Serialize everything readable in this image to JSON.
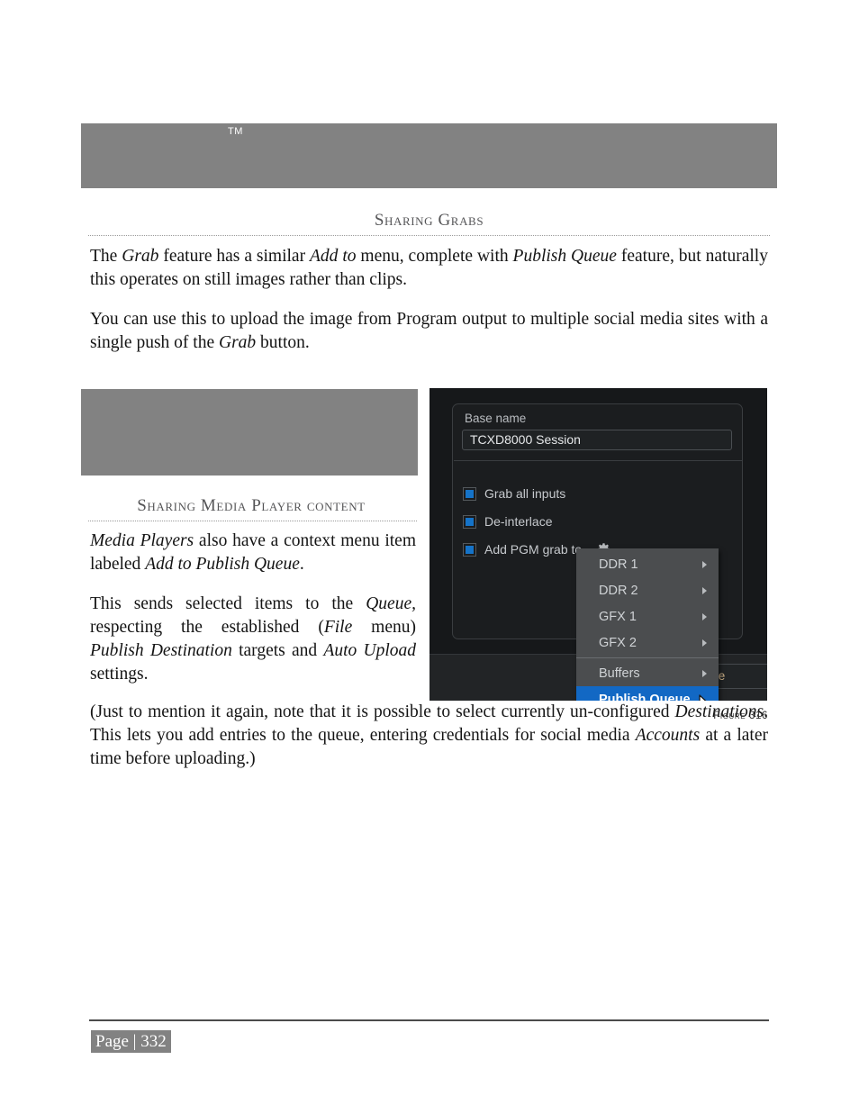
{
  "document": {
    "header_band": {
      "trademark": "TM"
    },
    "footer": {
      "page_label": "Page | 332"
    },
    "figure_caption": "Figure 316"
  },
  "sections": [
    {
      "heading": "Sharing Grabs"
    },
    {
      "heading": "Sharing Media Player content"
    }
  ],
  "paragraphs": {
    "grab_feature": {
      "part1": "The ",
      "em1": "Grab",
      "part2": " feature has a similar ",
      "em2": "Add to",
      "part3": " menu, complete with ",
      "em3": "Publish Queue",
      "part4": " feature, but naturally this operates on still images rather than clips."
    },
    "upload_image": {
      "part1": "You can use this to upload the image from Program output to multiple social media sites with a single push of the ",
      "em1": "Grab",
      "part2": " button."
    },
    "media_players": {
      "em1": "Media Players",
      "part1": " also have a context menu item labeled ",
      "em2": "Add to Publish Queue",
      "part2": "."
    },
    "sends_selected": {
      "part1": "This sends selected items to the ",
      "em1": "Queue,",
      "part2": " respecting the established (",
      "em2": "File",
      "part3": " menu) ",
      "em3": "Publish Destination",
      "part4": " targets and ",
      "em4": "Auto Upload",
      "part5": " settings."
    },
    "just_mention": {
      "part1": "(Just to mention it again, note that it is possible to select currently un-configured ",
      "em1": "Destinations",
      "part2": ". This lets you add entries to the queue, entering credentials for social media ",
      "em2": "Accounts",
      "part3": " at a later time before uploading.)"
    }
  },
  "app_screenshot": {
    "base_name": {
      "label": "Base name",
      "value": "TCXD8000 Session"
    },
    "checkboxes": [
      {
        "label": "Grab all inputs",
        "checked": true
      },
      {
        "label": "De-interlace",
        "checked": true
      },
      {
        "label": "Add PGM grab to",
        "checked": true,
        "icon": "gear-icon"
      }
    ],
    "footer_button": {
      "label": "se"
    },
    "context_menu": {
      "items": [
        {
          "label": "DDR 1",
          "submenu": true,
          "selected": false
        },
        {
          "label": "DDR 2",
          "submenu": true,
          "selected": false
        },
        {
          "label": "GFX 1",
          "submenu": true,
          "selected": false
        },
        {
          "label": "GFX 2",
          "submenu": true,
          "selected": false
        },
        {
          "label": "Buffers",
          "submenu": true,
          "selected": false,
          "separator_before": true
        },
        {
          "label": "Publish Queue",
          "submenu": false,
          "selected": true
        }
      ]
    },
    "colors": {
      "window_bg": "#16181a",
      "card_bg": "#1b1d1f",
      "menu_bg": "#4b4d4f",
      "accent_blue": "#1268c4",
      "checkbox_fill": "#1573c8",
      "text": "#c6c9cd"
    }
  }
}
